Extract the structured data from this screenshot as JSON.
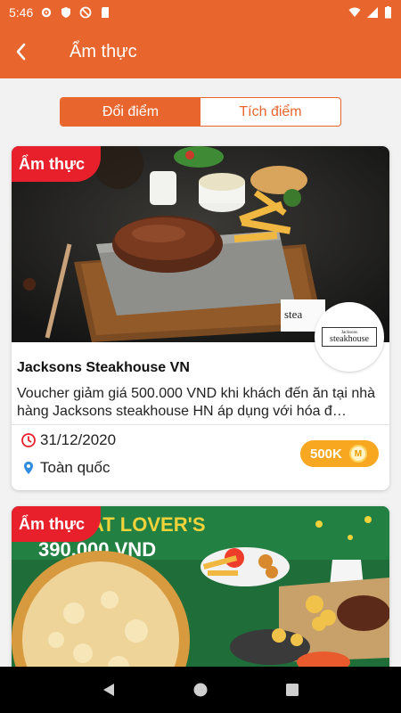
{
  "status_bar": {
    "time": "5:46"
  },
  "app_bar": {
    "title": "Ẩm thực"
  },
  "tabs": [
    {
      "label": "Đổi điểm",
      "active": true
    },
    {
      "label": "Tích điểm",
      "active": false
    }
  ],
  "cards": [
    {
      "tag": "Ẩm thực",
      "logo_line1": "Jacksons",
      "logo_line2": "steakhouse",
      "title": "Jacksons Steakhouse VN",
      "description": "Voucher giảm giá 500.000 VND khi khách đến ăn tại nhà hàng Jacksons steakhouse HN áp dụng với hóa đ…",
      "date": "31/12/2020",
      "location": "Toàn quốc",
      "points": "500K",
      "coin_letter": "M"
    },
    {
      "tag": "Ẩm thực",
      "banner_line1": "MEAT LOVER'S",
      "banner_line2": "390.000 VND"
    }
  ],
  "colors": {
    "primary": "#e8662e",
    "tag_red": "#e8202b",
    "points_orange": "#f7a820"
  },
  "icons": [
    "back-arrow-icon",
    "clock-icon",
    "location-pin-icon",
    "coin-icon",
    "nav-back-icon",
    "nav-home-icon",
    "nav-recents-icon"
  ]
}
